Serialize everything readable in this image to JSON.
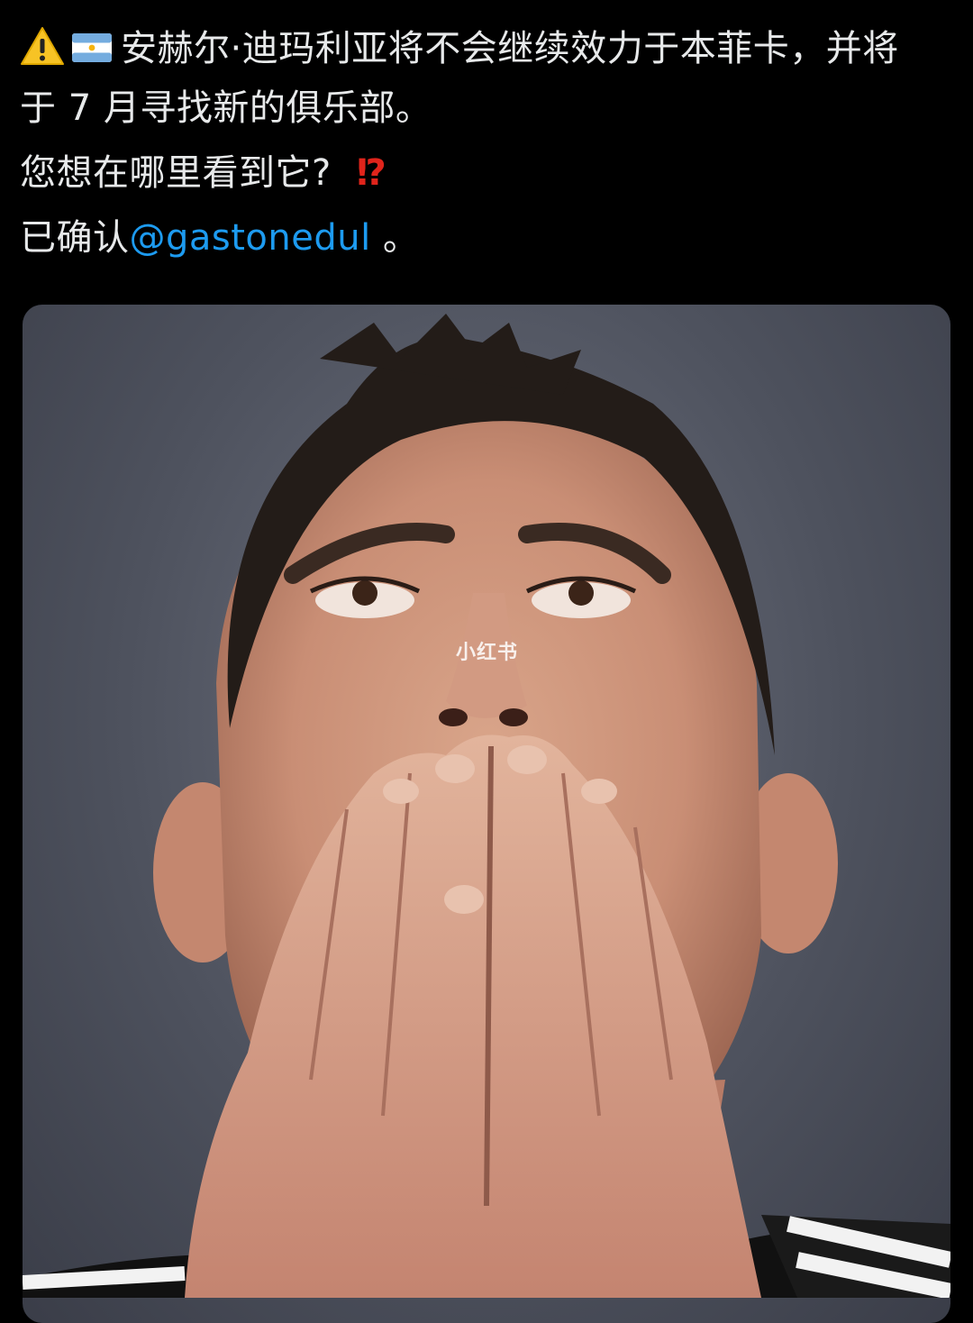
{
  "tweet": {
    "line1": "安赫尔·迪玛利亚将不会继续效力于本菲卡，并将",
    "line2": "于 7 月寻找新的俱乐部。",
    "question": "您想在哪里看到它?",
    "interrobang": "⁉",
    "confirmed_prefix": "已确认",
    "mention": "@gastonedul",
    "confirmed_suffix": " 。",
    "icons": [
      "warning-icon",
      "argentina-flag-icon"
    ]
  },
  "watermark": "小红书",
  "colors": {
    "background": "#000000",
    "text": "#e7e9ea",
    "mention": "#1d9bf0",
    "interrobang": "#e0241b"
  }
}
